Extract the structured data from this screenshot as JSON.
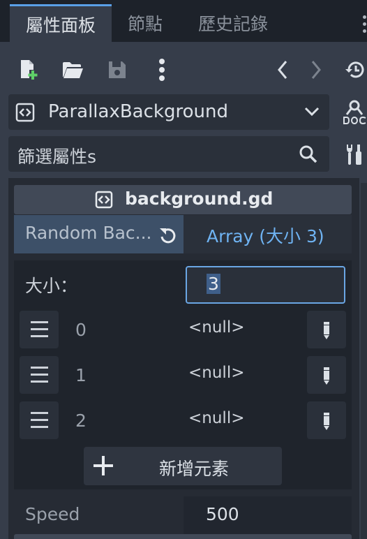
{
  "tabs": {
    "inspector": "屬性面板",
    "node": "節點",
    "history": "歷史記錄"
  },
  "toolbar": {
    "icons": [
      "new-script-icon",
      "open-folder-icon",
      "save-icon",
      "more-vert-icon",
      "back-arrow-icon",
      "forward-arrow-icon",
      "history-icon"
    ]
  },
  "object_selector": {
    "name": "ParallaxBackground"
  },
  "filter": {
    "placeholder": "篩選屬性s"
  },
  "script_header": {
    "label": "background.gd"
  },
  "property": {
    "name": "Random Bac...",
    "value": "Array (大小 3)"
  },
  "array": {
    "size_label": "大小：",
    "size_value": "3",
    "items": [
      {
        "index": "0",
        "value": "<null>"
      },
      {
        "index": "1",
        "value": "<null>"
      },
      {
        "index": "2",
        "value": "<null>"
      }
    ],
    "add_label": "新增元素"
  },
  "speed": {
    "label": "Speed",
    "value": "500"
  },
  "colors": {
    "accent": "#5aa0e8",
    "panel": "#363d4a",
    "field": "#2a303a",
    "text": "#cdd2d9"
  }
}
